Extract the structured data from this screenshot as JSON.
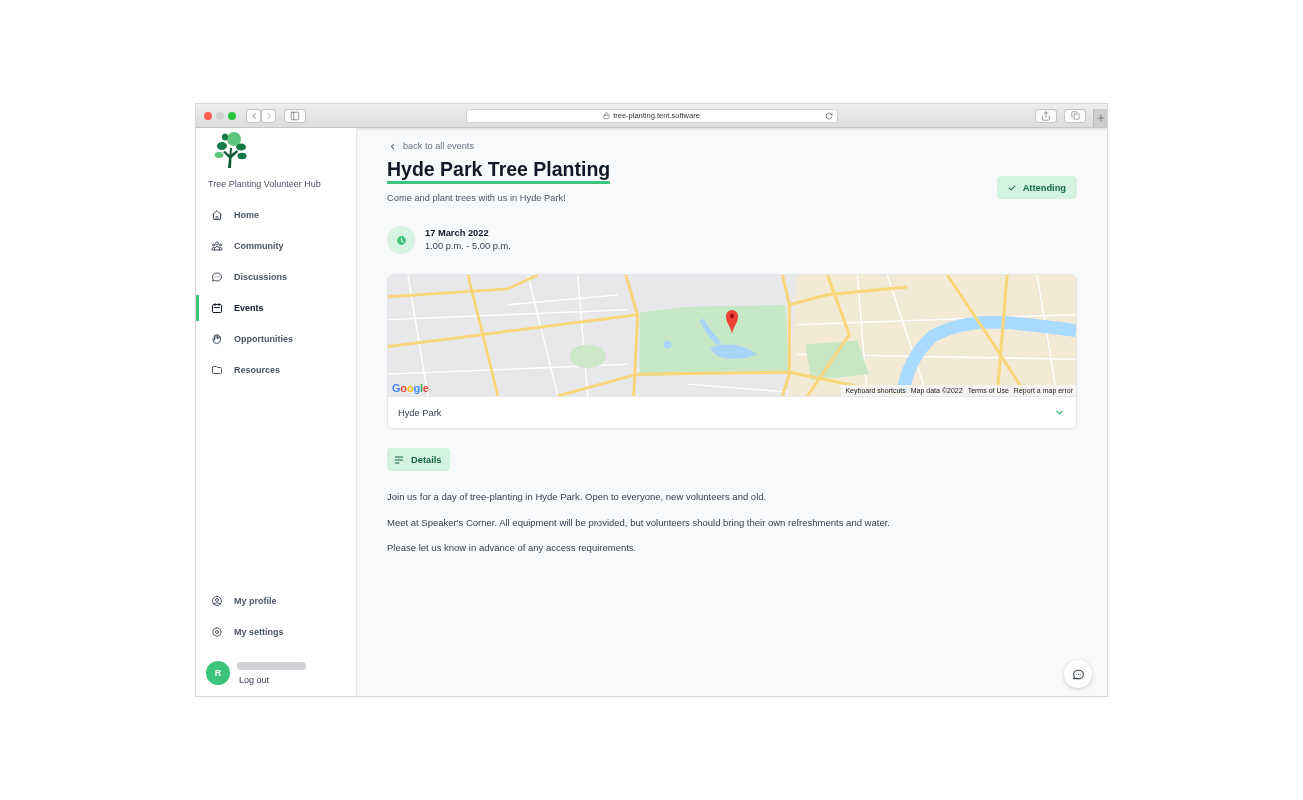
{
  "browser": {
    "url": "tree-planting.tent.software"
  },
  "sidebar": {
    "app_name": "Tree Planting Volunteer Hub",
    "nav_items": [
      {
        "label": "Home",
        "selected": false
      },
      {
        "label": "Community",
        "selected": false
      },
      {
        "label": "Discussions",
        "selected": false
      },
      {
        "label": "Events",
        "selected": true
      },
      {
        "label": "Opportunities",
        "selected": false
      },
      {
        "label": "Resources",
        "selected": false
      }
    ],
    "footer_items": [
      {
        "label": "My profile",
        "selected": false
      },
      {
        "label": "My settings",
        "selected": false
      }
    ],
    "user": {
      "avatar_initial": "R",
      "logout": "Log out"
    }
  },
  "event": {
    "back_link": "back to all events",
    "title": "Hyde Park Tree Planting",
    "subtitle": "Come and plant trees with us in Hyde Park!",
    "attendance": {
      "label": "Attending",
      "on": true
    },
    "date": "17 March 2022",
    "time": "1.00 p.m. - 5.00 p.m.",
    "location": {
      "name": "Hyde Park",
      "expanded": false,
      "map": {
        "logo": "Google",
        "credits": [
          "Keyboard shortcuts",
          "Map data ©2022",
          "Terms of Use",
          "Report a map error"
        ]
      }
    },
    "details_button": "Details",
    "description": [
      "Join us for a day of tree-planting in Hyde Park. Open to everyone, new volunteers and old.",
      "Meet at Speaker's Corner. All equipment will be provided, but volunteers should bring their own refreshments and water.",
      "Please let us know in advance of any access requirements."
    ]
  }
}
